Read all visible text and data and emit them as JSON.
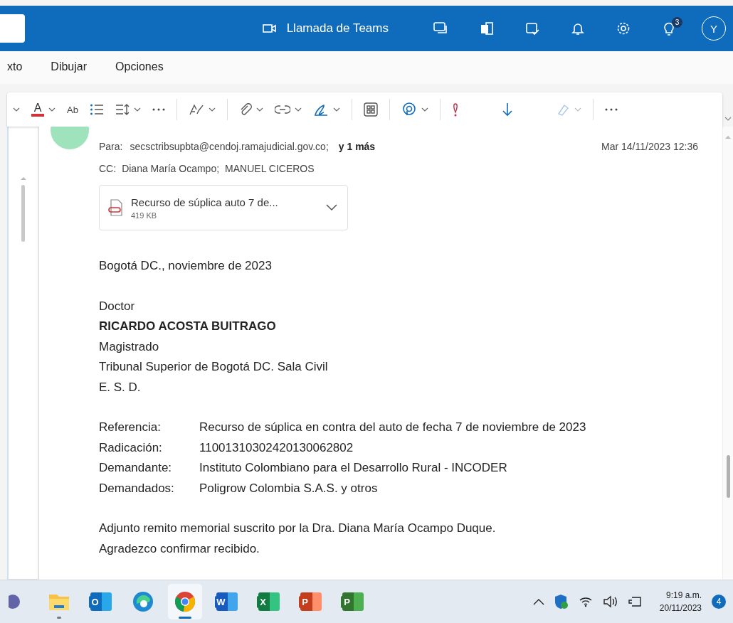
{
  "top_bar": {
    "teams_call": "Llamada de Teams",
    "tips_badge": "3",
    "avatar": "Y"
  },
  "menu_tabs": [
    {
      "label": "xto",
      "selected": false
    },
    {
      "label": "Dibujar",
      "selected": false
    },
    {
      "label": "Opciones",
      "selected": false
    }
  ],
  "toolbar": {
    "font_color_letter": "A",
    "spelling_letters": "Ab"
  },
  "message": {
    "to_label": "Para:",
    "to": "secsctribsupbta@cendoj.ramajudicial.gov.co;",
    "to_more": "y 1 más",
    "date": "Mar 14/11/2023 12:36",
    "cc_label": "CC:",
    "cc": [
      "Diana María Ocampo;",
      "MANUEL CICEROS"
    ],
    "attachment": {
      "name": "Recurso de súplica auto 7 de...",
      "size": "419 KB"
    },
    "body": [
      {
        "kind": "paragraph",
        "lines": [
          {
            "text": " Bogotá DC., noviembre de 2023",
            "bold": false
          }
        ]
      },
      {
        "kind": "paragraph",
        "lines": [
          {
            "text": "Doctor",
            "bold": false
          },
          {
            "text": "RICARDO ACOSTA BUITRAGO",
            "bold": true
          },
          {
            "text": "Magistrado",
            "bold": false
          },
          {
            "text": "Tribunal Superior de Bogotá DC. Sala Civil",
            "bold": false
          },
          {
            "text": "E.   S.   D.",
            "bold": false
          }
        ]
      },
      {
        "kind": "fields",
        "rows": [
          {
            "label": "Referencia:",
            "value": "Recurso de súplica en contra del auto de fecha 7 de noviembre de 2023"
          },
          {
            "label": "Radicación:",
            "value": "11001310302420130062802"
          },
          {
            "label": "Demandante:",
            "value": "Instituto Colombiano para el Desarrollo Rural - INCODER"
          },
          {
            "label": "Demandados:",
            "value": "Poligrow Colombia S.A.S. y otros"
          }
        ]
      },
      {
        "kind": "paragraph",
        "lines": [
          {
            "text": "Adjunto remito memorial suscrito por la Dra. Diana María Ocampo Duque.",
            "bold": false
          },
          {
            "text": "Agradezco confirmar recibido.",
            "bold": false
          }
        ]
      }
    ]
  },
  "taskbar": {
    "apps": [
      {
        "kind": "teams",
        "selected": false,
        "running": false
      },
      {
        "kind": "explorer",
        "selected": false,
        "running": true
      },
      {
        "kind": "outlook",
        "letter": "O",
        "selected": false,
        "running": false
      },
      {
        "kind": "edge",
        "selected": false,
        "running": false
      },
      {
        "kind": "chrome",
        "selected": true,
        "running": true
      },
      {
        "kind": "word",
        "letter": "W",
        "selected": false,
        "running": false
      },
      {
        "kind": "excel",
        "letter": "X",
        "selected": false,
        "running": false
      },
      {
        "kind": "powerpoint",
        "letter": "P",
        "selected": false,
        "running": false
      },
      {
        "kind": "project",
        "letter": "P",
        "selected": false,
        "running": false
      }
    ],
    "time": "9:19 a.m.",
    "date": "20/11/2023",
    "notifications": "4"
  }
}
